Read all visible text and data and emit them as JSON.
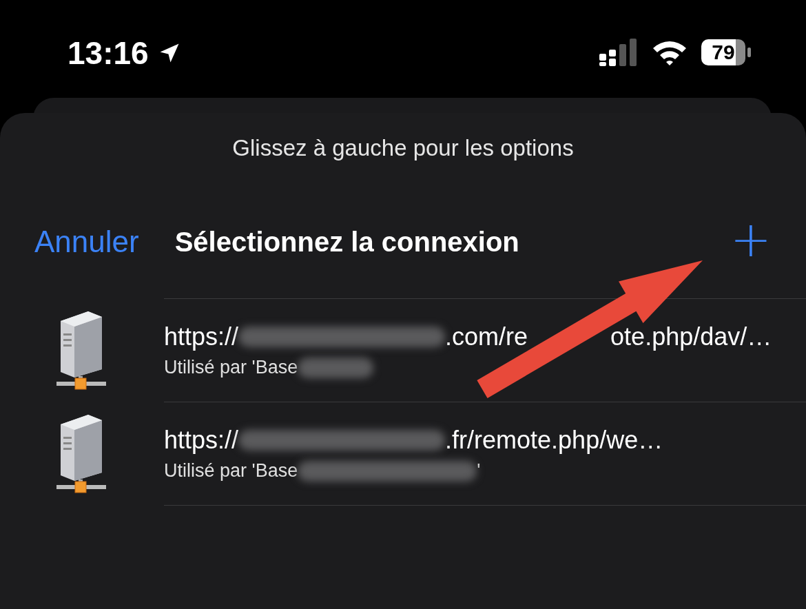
{
  "status_bar": {
    "time": "13:16",
    "battery": "79"
  },
  "sheet": {
    "hint": "Glissez à gauche pour les options",
    "cancel": "Annuler",
    "title": "Sélectionnez la connexion",
    "add": "+"
  },
  "connections": [
    {
      "url_start": "https://",
      "url_end": ".com/re",
      "url_tail": "ote.php/dav/…",
      "subtitle_start": "Utilisé par 'Base"
    },
    {
      "url_start": "https://",
      "url_end": ".fr/remote.php/we…",
      "subtitle_start": "Utilisé par 'Base",
      "subtitle_end": "'"
    }
  ]
}
